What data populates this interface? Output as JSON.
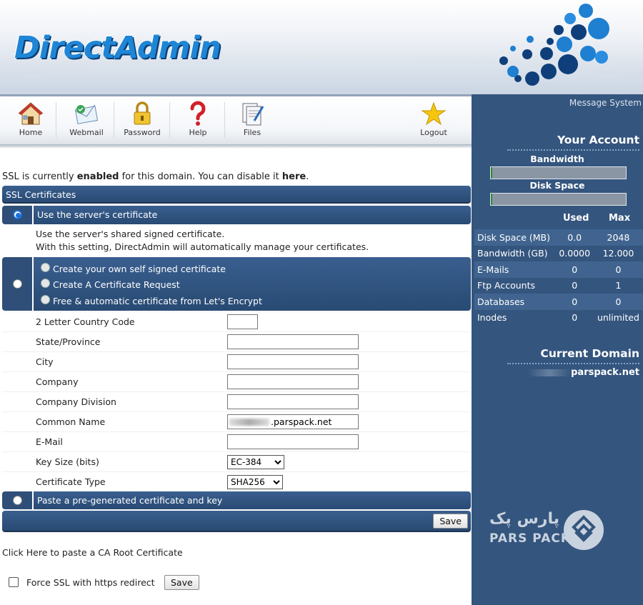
{
  "header": {
    "logo_text": "DirectAdmin"
  },
  "toolbar": {
    "items": [
      {
        "label": "Home",
        "icon": "home-icon"
      },
      {
        "label": "Webmail",
        "icon": "webmail-icon"
      },
      {
        "label": "Password",
        "icon": "padlock-icon"
      },
      {
        "label": "Help",
        "icon": "question-mark-icon"
      },
      {
        "label": "Files",
        "icon": "files-icon"
      },
      {
        "label": "Logout",
        "icon": "star-icon"
      }
    ]
  },
  "main": {
    "status_prefix": "SSL is currently ",
    "status_word": "enabled",
    "status_mid": " for this domain. You can disable it ",
    "status_link": "here",
    "status_end": ".",
    "section_title": "SSL Certificates",
    "option_server": "Use the server's certificate",
    "server_desc_1": "Use the server's shared signed certificate.",
    "server_desc_2": "With this setting, DirectAdmin will automatically manage your certificates.",
    "sub_options": [
      "Create your own self signed certificate",
      "Create A Certificate Request",
      "Free & automatic certificate from Let's Encrypt"
    ],
    "fields": {
      "country": {
        "label": "2 Letter Country Code",
        "value": ""
      },
      "state": {
        "label": "State/Province",
        "value": ""
      },
      "city": {
        "label": "City",
        "value": ""
      },
      "company": {
        "label": "Company",
        "value": ""
      },
      "division": {
        "label": "Company Division",
        "value": ""
      },
      "common_name": {
        "label": "Common Name",
        "value": ".parspack.net"
      },
      "email": {
        "label": "E-Mail",
        "value": ""
      },
      "key_size": {
        "label": "Key Size (bits)",
        "value": "EC-384"
      },
      "cert_type": {
        "label": "Certificate Type",
        "value": "SHA256"
      }
    },
    "option_paste": "Paste a pre-generated certificate and key",
    "save_label": "Save",
    "ca_root_link": "Click Here to paste a CA Root Certificate",
    "force_ssl_label": "Force SSL with https redirect",
    "force_ssl_save": "Save"
  },
  "sidebar": {
    "message_system": "Message System",
    "your_account": "Your Account",
    "bandwidth_label": "Bandwidth",
    "bandwidth_fraction": 0.01,
    "disk_label": "Disk Space",
    "disk_fraction": 0.01,
    "col_used": "Used",
    "col_max": "Max",
    "usage": [
      {
        "name": "Disk Space (MB)",
        "used": "0.0",
        "max": "2048"
      },
      {
        "name": "Bandwidth (GB)",
        "used": "0.0000",
        "max": "12.000"
      },
      {
        "name": "E-Mails",
        "used": "0",
        "max": "0"
      },
      {
        "name": "Ftp Accounts",
        "used": "0",
        "max": "1"
      },
      {
        "name": "Databases",
        "used": "0",
        "max": "0"
      },
      {
        "name": "Inodes",
        "used": "0",
        "max": "unlimited"
      }
    ],
    "current_domain_title": "Current Domain",
    "current_domain": "parspack.net"
  },
  "watermark": {
    "text_fa": "پارس پک",
    "text_en": "PARS PACK"
  },
  "colors": {
    "sidebar": "#34557e",
    "bar": "#2f4f78",
    "logo": "#1f86d6",
    "radio_selected": "#1d6fd6"
  }
}
